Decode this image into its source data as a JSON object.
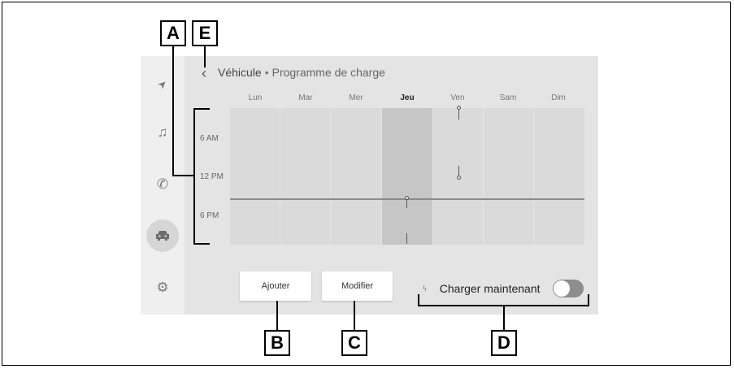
{
  "header": {
    "back_icon": "chevron-left-icon",
    "breadcrumb_parent": "Véhicule",
    "breadcrumb_separator": "•",
    "title": "Programme de charge"
  },
  "sidebar": {
    "items": [
      {
        "icon": "navigation-icon",
        "glyph": "➤"
      },
      {
        "icon": "music-icon",
        "glyph": "♫"
      },
      {
        "icon": "phone-icon",
        "glyph": "✆"
      },
      {
        "icon": "car-icon",
        "glyph": "🚘",
        "active": true
      },
      {
        "icon": "gear-icon",
        "glyph": "⚙"
      }
    ]
  },
  "schedule": {
    "days": [
      "Lun",
      "Mar",
      "Mer",
      "Jeu",
      "Ven",
      "Sam",
      "Dim"
    ],
    "today_index": 3,
    "time_labels": [
      "6 AM",
      "12 PM",
      "6 PM"
    ]
  },
  "buttons": {
    "add": "Ajouter",
    "edit": "Modifier"
  },
  "charge_now": {
    "label": "Charger maintenant",
    "icon": "bolt-icon",
    "enabled": false
  },
  "callouts": {
    "a": "A",
    "b": "B",
    "c": "C",
    "d": "D",
    "e": "E"
  }
}
